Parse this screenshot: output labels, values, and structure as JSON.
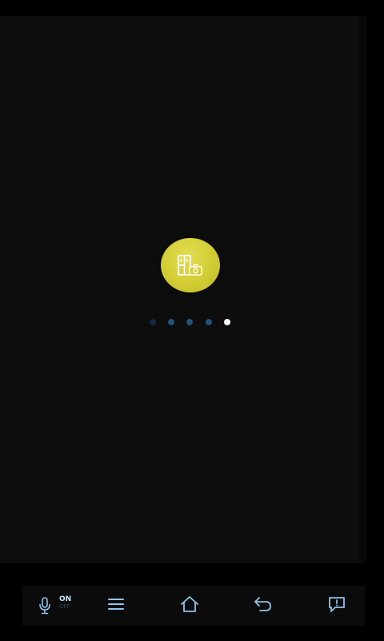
{
  "colors": {
    "background": "#000000",
    "panel": "#0d0d0d",
    "badge_yellow": "#d6d13a",
    "dot_active": "#ffffff",
    "dot_inactive": "#23527c",
    "dot_dim": "#132a40",
    "nav_icon": "#8fc4ec"
  },
  "app_icon": {
    "name": "building-camera-icon"
  },
  "pager": {
    "count": 5,
    "active_index": 4
  },
  "navbar": {
    "mic_toggle": {
      "icon": "microphone-icon",
      "state_on": "ON",
      "state_off": "OFF"
    },
    "buttons": [
      {
        "icon": "menu-icon"
      },
      {
        "icon": "home-icon"
      },
      {
        "icon": "back-icon"
      },
      {
        "icon": "feedback-icon"
      }
    ]
  }
}
